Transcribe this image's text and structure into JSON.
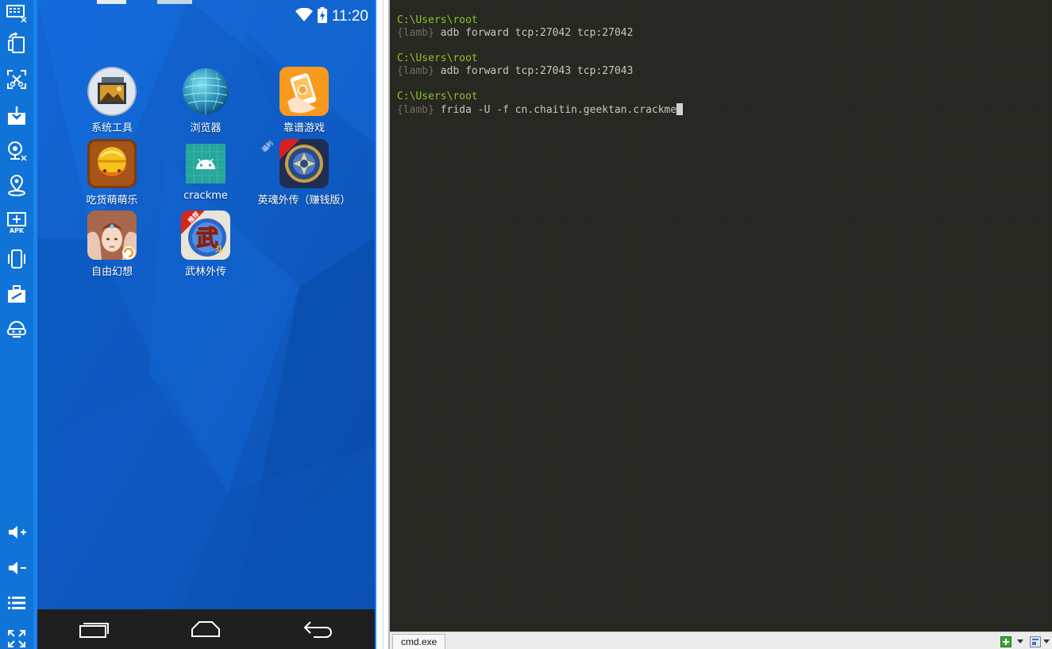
{
  "emulator": {
    "toolbar_icons": [
      "keyboard-icon",
      "rotate-screen-icon",
      "screenshot-icon",
      "install-icon",
      "camera-icon",
      "location-icon",
      "apk-icon",
      "shake-icon",
      "toolbox-icon",
      "multi-instance-icon",
      "volume-up-icon",
      "volume-down-icon",
      "menu-icon",
      "fullscreen-icon"
    ],
    "apk_label": "APK",
    "status": {
      "time": "11:20"
    },
    "apps": [
      {
        "label": "系统工具",
        "icon": "system-tools-icon"
      },
      {
        "label": "浏览器",
        "icon": "browser-icon"
      },
      {
        "label": "靠谱游戏",
        "icon": "kaopu-games-icon"
      },
      {
        "label": "吃货萌萌乐",
        "icon": "food-game-icon"
      },
      {
        "label": "crackme",
        "icon": "android-app-icon"
      },
      {
        "label": "英魂外传（赚钱版）",
        "icon": "yinghun-game-icon"
      },
      {
        "label": "自由幻想",
        "icon": "ziyou-game-icon"
      },
      {
        "label": "武林外传",
        "icon": "wulin-game-icon"
      }
    ],
    "yinghun_badge": "福利",
    "wulin_badge": "推荐",
    "wulin_glyph": "武",
    "wulin_glyph2": "斗",
    "navbar": [
      "recent-apps-icon",
      "home-icon",
      "back-icon"
    ]
  },
  "terminal": {
    "lines": [
      {
        "path": "C:\\Users\\root",
        "prompt": "{lamb}",
        "cmd": "adb forward tcp:27042 tcp:27042"
      },
      {
        "path": "C:\\Users\\root",
        "prompt": "{lamb}",
        "cmd": "adb forward tcp:27043 tcp:27043"
      },
      {
        "path": "C:\\Users\\root",
        "prompt": "{lamb}",
        "cmd": "frida -U -f cn.chaitin.geektan.crackme"
      }
    ],
    "tab_label": "cmd.exe",
    "colors": {
      "background": "#272822",
      "path": "#8ec22a",
      "prompt": "#6f6f65",
      "command": "#c7c7bd"
    }
  },
  "colors": {
    "emulator_toolbar": "#1073d8",
    "phone_wallpaper": "#0d5fc7"
  }
}
